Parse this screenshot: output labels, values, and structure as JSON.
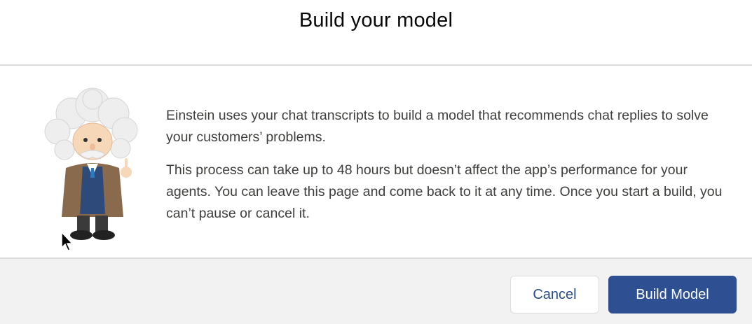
{
  "modal": {
    "title": "Build your model",
    "body": {
      "paragraph_1": "Einstein uses your chat transcripts to build a model that recommends chat replies to solve your customers’ problems.",
      "paragraph_2": "This process can take up to 48 hours but doesn’t affect the app’s performance for your agents. You can leave this page and come back to it at any time. Once you start a build, you can’t pause or cancel it."
    },
    "illustration": "einstein-character-illustration",
    "footer": {
      "cancel_label": "Cancel",
      "build_label": "Build Model"
    }
  },
  "colors": {
    "brand": "#2e5092",
    "footer_bg": "#f3f2f2",
    "border": "#dddbda",
    "text": "#3e3e3c"
  },
  "cursor": "arrow-cursor"
}
